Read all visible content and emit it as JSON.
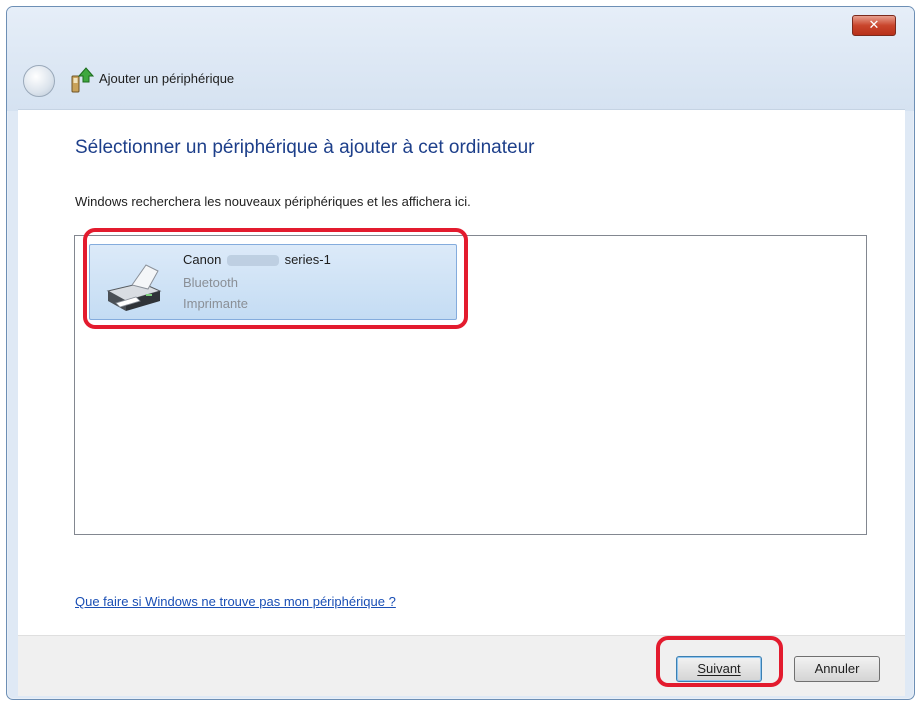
{
  "window": {
    "title": "Ajouter un périphérique",
    "close_label": "✕"
  },
  "main": {
    "heading": "Sélectionner un périphérique à ajouter à cet ordinateur",
    "description": "Windows recherchera les nouveaux périphériques et les affichera ici.",
    "devices": [
      {
        "name_prefix": "Canon",
        "name_suffix": "series-1",
        "connection": "Bluetooth",
        "type": "Imprimante",
        "icon": "printer-icon",
        "selected": true
      }
    ],
    "help_link": "Que faire si Windows ne trouve pas mon périphérique ?"
  },
  "footer": {
    "next_label": "Suivant",
    "cancel_label": "Annuler"
  },
  "colors": {
    "highlight": "#e31b2e",
    "heading": "#1d3f8a",
    "link": "#1a4fb5",
    "selection": "#c4dcf3"
  }
}
